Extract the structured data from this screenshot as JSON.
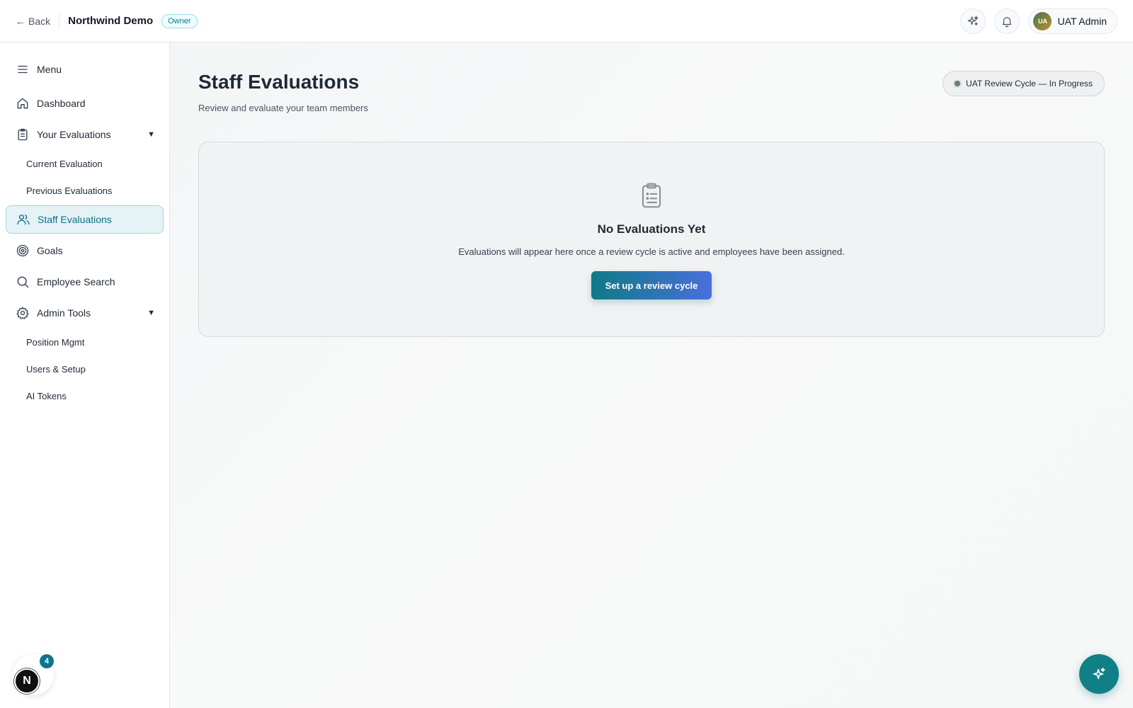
{
  "topbar": {
    "back_label": "Back",
    "org_name": "Northwind Demo",
    "role_badge": "Owner",
    "user": {
      "initials": "UA",
      "name": "UAT Admin"
    },
    "icons": [
      "sparkles-icon",
      "bell-icon"
    ]
  },
  "sidebar": {
    "menu_label": "Menu",
    "items": {
      "dashboard": "Dashboard",
      "your_evaluations": "Your Evaluations",
      "current_evaluation": "Current Evaluation",
      "previous_evaluations": "Previous Evaluations",
      "staff_evaluations": "Staff Evaluations",
      "goals": "Goals",
      "employee_search": "Employee Search",
      "admin_tools": "Admin Tools",
      "position_mgmt": "Position Mgmt",
      "users_setup": "Users & Setup",
      "ai_tokens": "AI Tokens"
    },
    "active_item": "Staff Evaluations"
  },
  "main": {
    "title": "Staff Evaluations",
    "subtitle": "Review and evaluate your team members",
    "cycle_status": "UAT Review Cycle — In Progress",
    "empty_state": {
      "title": "No Evaluations Yet",
      "description": "Evaluations will appear here once a review cycle is active and employees have been assigned.",
      "button_label": "Set up a review cycle"
    }
  },
  "widgets": {
    "dev_badge_letter": "N",
    "dev_badge_count": "4"
  },
  "colors": {
    "accent": "#0e7490",
    "active_bg": "#e6f3f6",
    "fab": "#117f86"
  }
}
